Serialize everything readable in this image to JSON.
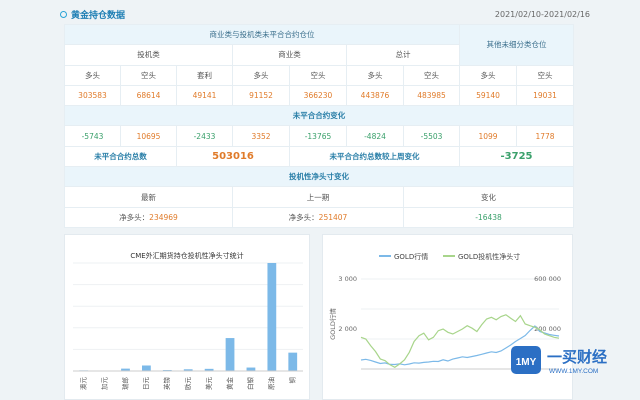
{
  "header": {
    "title": "黄金持仓数据",
    "date_range": "2021/02/10-2021/02/16"
  },
  "table": {
    "section_nonclosed": "商业类与投机类未平合合约仓位",
    "other_unclassified": "其他未细分类仓位",
    "group_spec": "投机类",
    "group_comm": "商业类",
    "group_total": "总计",
    "col_long": "多头",
    "col_short": "空头",
    "col_arb": "套利",
    "positions": [
      "303583",
      "68614",
      "49141",
      "91152",
      "366230",
      "443876",
      "483985",
      "59140",
      "19031"
    ],
    "section_change": "未平合合约变化",
    "changes": [
      "-5743",
      "10695",
      "-2433",
      "3352",
      "-13765",
      "-4824",
      "-5503",
      "1099",
      "1778"
    ],
    "total_oi_label": "未平合合约总数",
    "total_oi_value": "503016",
    "oi_change_label": "未平合合约总数较上周变化",
    "oi_change_value": "-3725",
    "section_net": "投机性净头寸变化",
    "col_latest": "最新",
    "col_prev": "上一期",
    "col_change": "变化",
    "net_label": "净多头：",
    "net_latest": "234969",
    "net_prev": "251407",
    "net_change": "-16438"
  },
  "chart_data": [
    {
      "type": "bar",
      "title": "CME外汇期货持仓投机性净头寸统计",
      "categories": [
        "澳元",
        "加元",
        "瑞郎",
        "日元",
        "英镑",
        "欧元",
        "美元",
        "黄金",
        "白银",
        "原油",
        "铜"
      ],
      "values": [
        0.6,
        0.4,
        2.2,
        5.1,
        0.9,
        1.6,
        2.0,
        30.5,
        3.2,
        100,
        17.0
      ],
      "bar_color": "#7cb9e8"
    },
    {
      "type": "line",
      "legend": [
        "GOLD行情",
        "GOLD投机性净头寸"
      ],
      "legend_position": "top",
      "series_colors": [
        "#7cb9e8",
        "#a8d58b"
      ],
      "ylabel_left": "GOLD行情",
      "yticks_left": [
        "3 000",
        "2 000"
      ],
      "yticks_right": [
        "600 000",
        "200 000"
      ],
      "series": [
        {
          "name": "GOLD行情",
          "values": [
            1380,
            1395,
            1372,
            1340,
            1310,
            1322,
            1292,
            1290,
            1305,
            1285,
            1300,
            1325,
            1318,
            1332,
            1340,
            1355,
            1350,
            1385,
            1360,
            1398,
            1420,
            1445,
            1430,
            1450,
            1470,
            1495,
            1520,
            1545,
            1530,
            1560,
            1620,
            1680,
            1750,
            1810,
            1870,
            1970,
            2060,
            1950,
            1920,
            1890,
            1875,
            1860
          ]
        },
        {
          "name": "GOLD投机性净头寸",
          "values": [
            250000,
            240000,
            200000,
            165000,
            120000,
            110000,
            85000,
            70000,
            90000,
            115000,
            160000,
            225000,
            260000,
            275000,
            235000,
            250000,
            290000,
            300000,
            280000,
            270000,
            285000,
            300000,
            320000,
            305000,
            285000,
            325000,
            360000,
            370000,
            355000,
            375000,
            385000,
            365000,
            345000,
            380000,
            330000,
            320000,
            310000,
            295000,
            270000,
            260000,
            250000,
            245000
          ]
        }
      ]
    }
  ],
  "watermark": {
    "logo_text": "1MY",
    "cn_text": "一买财经",
    "url": "WWW.1MY.COM"
  },
  "colors": {
    "accent": "#2aa4d6",
    "positive_num": "#e07b2a",
    "negative_num": "#3aa06b",
    "header_bg": "#eaf5fb"
  }
}
